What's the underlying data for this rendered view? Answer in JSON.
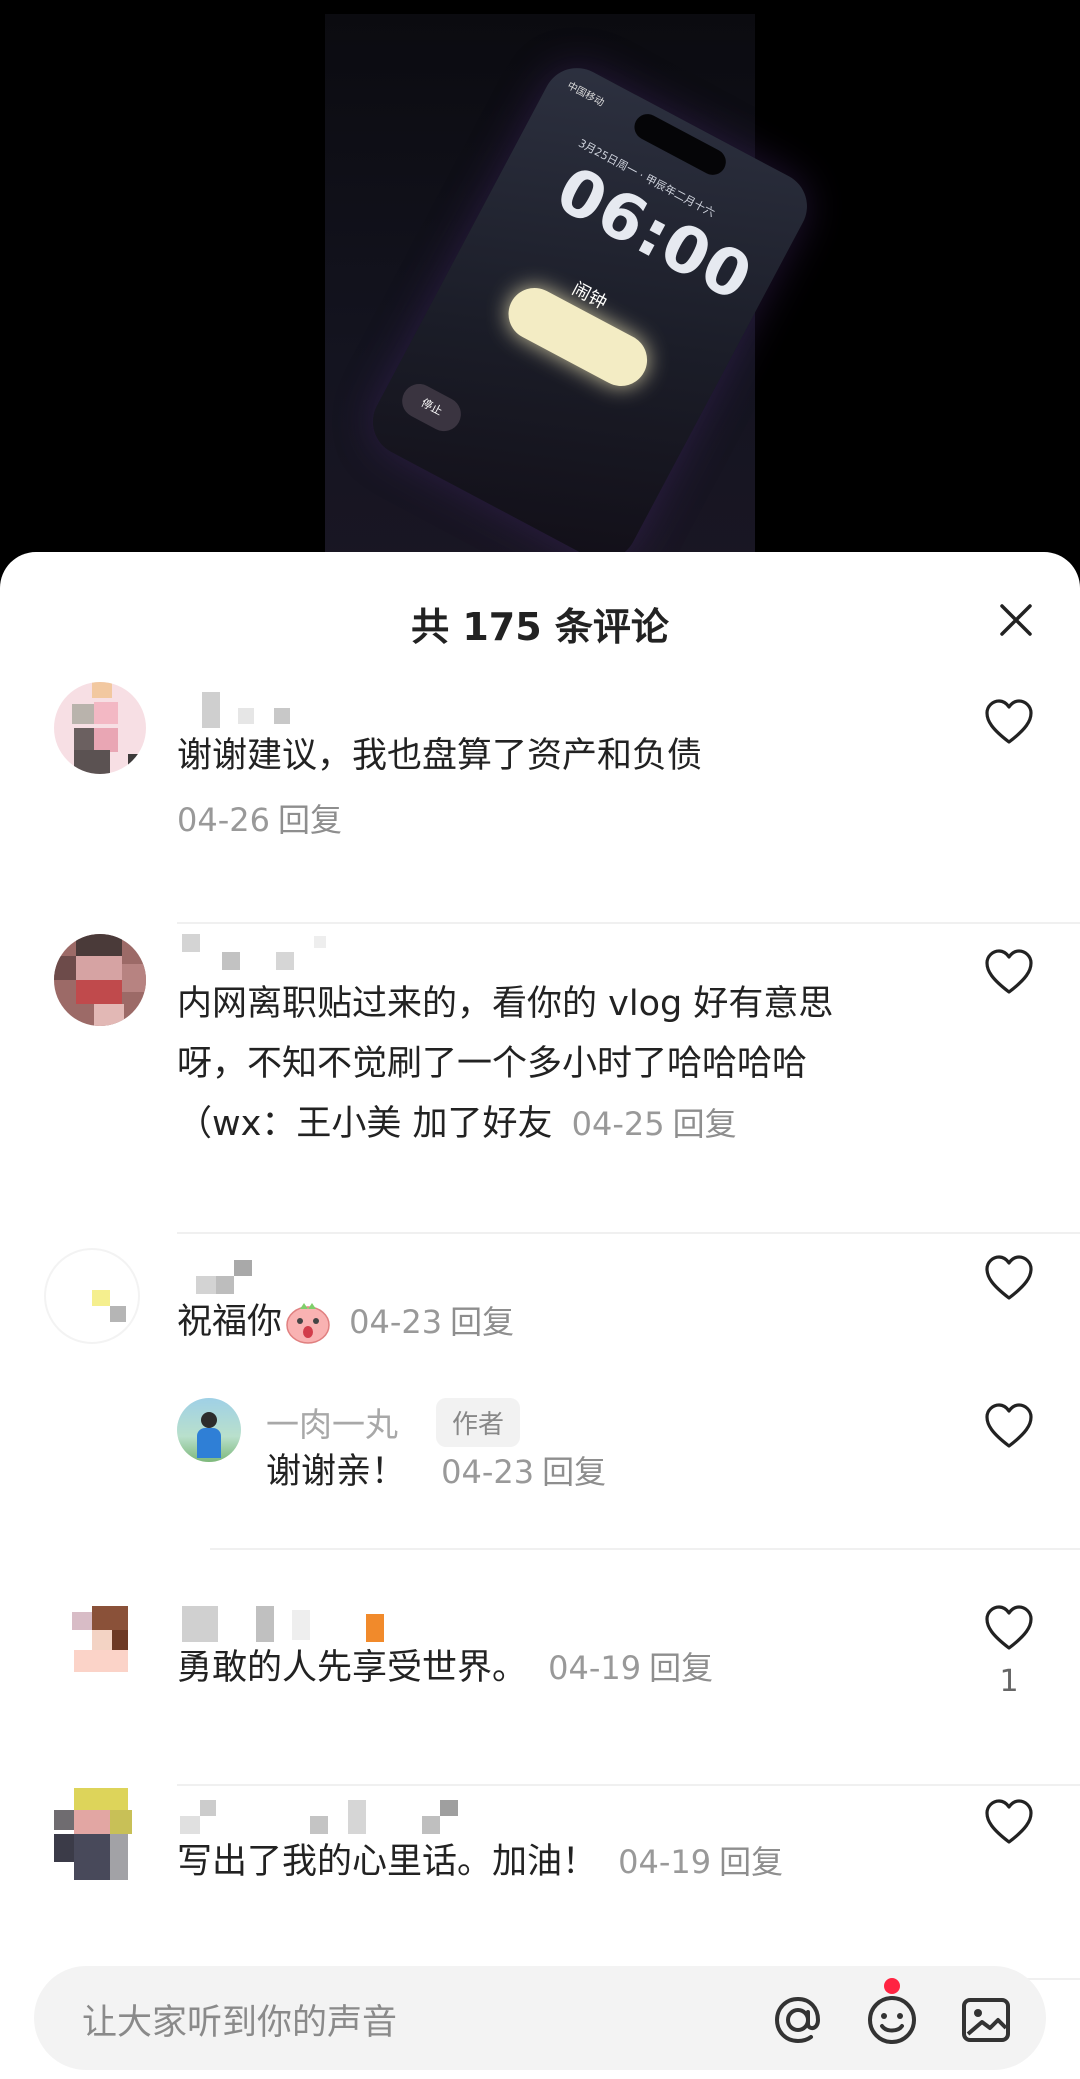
{
  "video": {
    "carrier": "中国移动",
    "date": "3月25日周一 · 甲辰年二月十六",
    "time": "06:00",
    "alarm_label": "闹钟",
    "stop_label": "停止"
  },
  "sheet": {
    "title": "共 175 条评论"
  },
  "comments": [
    {
      "text": "谢谢建议，我也盘算了资产和负债",
      "date": "04-26",
      "reply": "回复"
    },
    {
      "text_line1": "内网离职贴过来的，看你的 vlog 好有意思",
      "text_line2": "呀，不知不觉刷了一个多小时了哈哈哈哈",
      "text_line3": "（wx：王小美 加了好友",
      "date": "04-25",
      "reply": "回复"
    },
    {
      "text": "祝福你",
      "date": "04-23",
      "reply": "回复"
    },
    {
      "text": "勇敢的人先享受世界。",
      "date": "04-19",
      "reply": "回复",
      "like_count": "1"
    },
    {
      "text": "写出了我的心里话。加油！",
      "date": "04-19",
      "reply": "回复"
    }
  ],
  "author_reply": {
    "name": "一肉一丸",
    "badge": "作者",
    "text": "谢谢亲！",
    "date": "04-23",
    "reply": "回复"
  },
  "input": {
    "placeholder": "让大家听到你的声音"
  },
  "icons": {
    "close": "close-icon",
    "like": "heart-outline-icon",
    "mention": "at-icon",
    "emoji": "smiley-icon",
    "image": "image-icon"
  },
  "colors": {
    "notification_dot": "#ff2442",
    "text_primary": "#222222",
    "text_meta": "#999999"
  }
}
